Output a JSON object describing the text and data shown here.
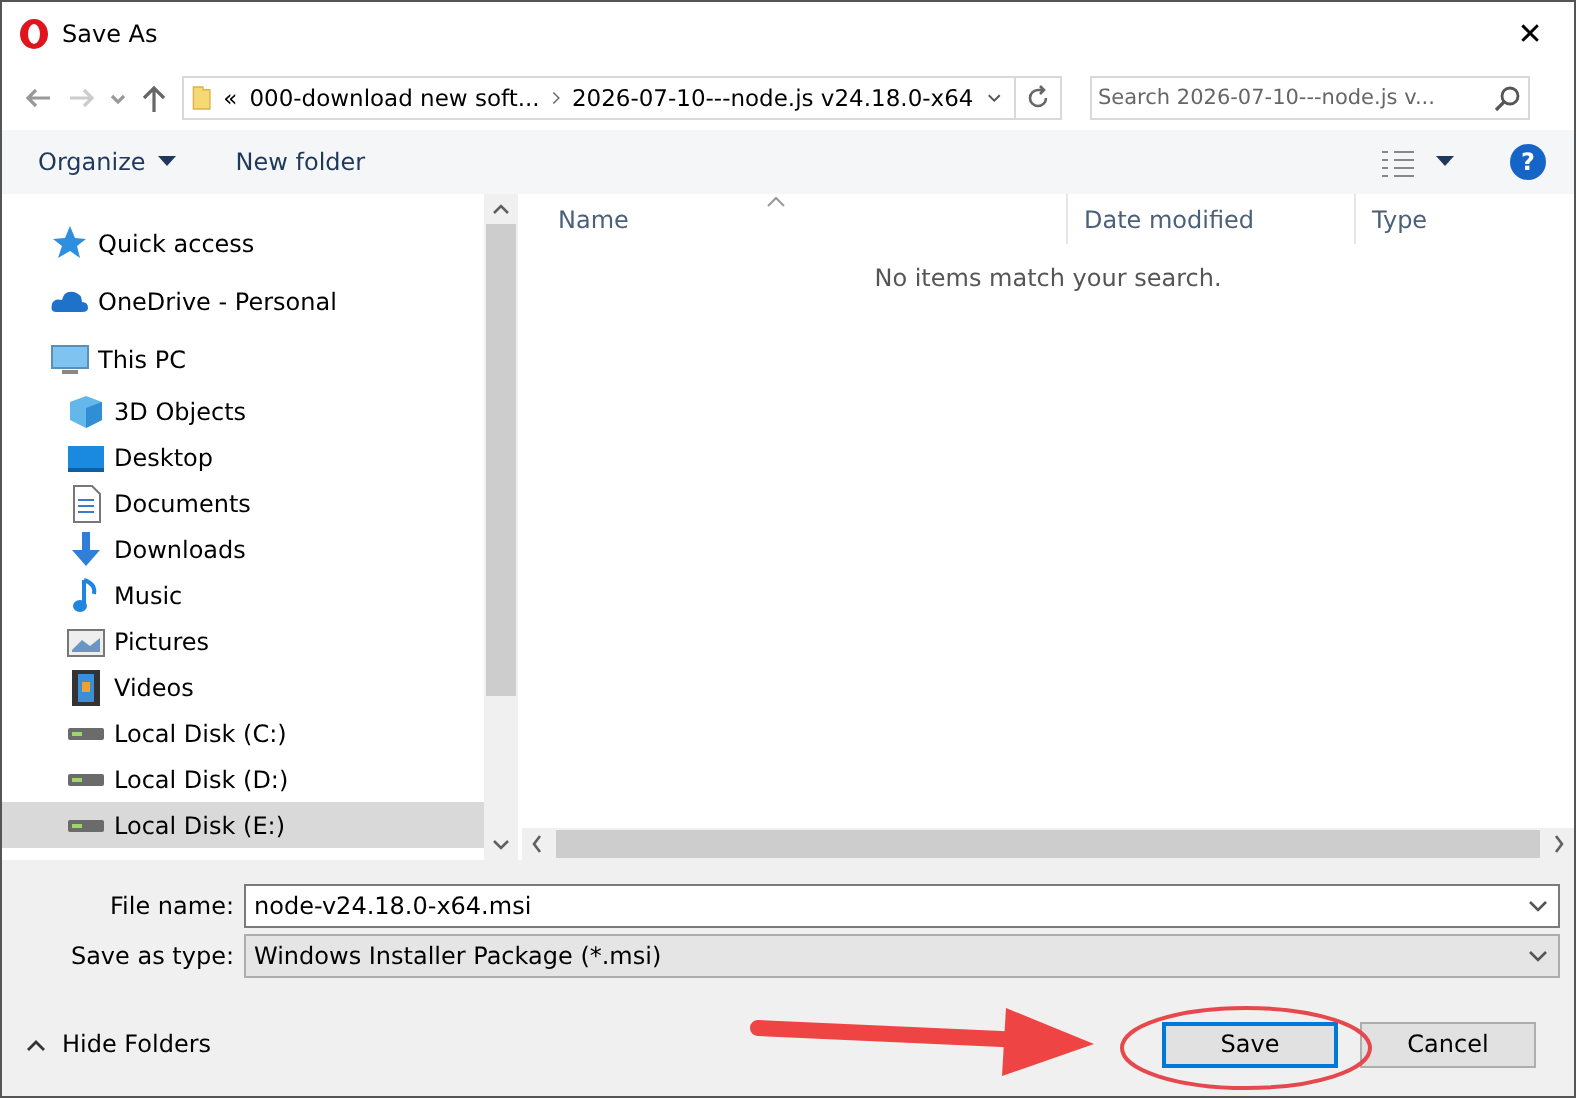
{
  "window": {
    "title": "Save As",
    "close": "✕"
  },
  "address": {
    "overflow": "«",
    "segments": [
      "000-download new soft...",
      "2026-07-10---node.js v24.18.0-x64"
    ]
  },
  "search": {
    "placeholder": "Search 2026-07-10---node.js v..."
  },
  "toolbar": {
    "organize": "Organize",
    "new_folder": "New folder",
    "help": "?"
  },
  "sidebar": {
    "items": [
      {
        "label": "Quick access",
        "kind": "star",
        "selected": false
      },
      {
        "label": "OneDrive - Personal",
        "kind": "cloud",
        "selected": false
      },
      {
        "label": "This PC",
        "kind": "pc",
        "selected": false,
        "children": [
          {
            "label": "3D Objects",
            "kind": "cube",
            "selected": false
          },
          {
            "label": "Desktop",
            "kind": "desktop",
            "selected": false
          },
          {
            "label": "Documents",
            "kind": "doc",
            "selected": false
          },
          {
            "label": "Downloads",
            "kind": "download",
            "selected": false
          },
          {
            "label": "Music",
            "kind": "music",
            "selected": false
          },
          {
            "label": "Pictures",
            "kind": "pictures",
            "selected": false
          },
          {
            "label": "Videos",
            "kind": "video",
            "selected": false
          },
          {
            "label": "Local Disk (C:)",
            "kind": "disk",
            "selected": false
          },
          {
            "label": "Local Disk (D:)",
            "kind": "disk",
            "selected": false
          },
          {
            "label": "Local Disk (E:)",
            "kind": "disk",
            "selected": true
          }
        ]
      }
    ]
  },
  "file_list": {
    "columns": [
      {
        "label": "Name",
        "sorted": true
      },
      {
        "label": "Date modified",
        "sorted": false
      },
      {
        "label": "Type",
        "sorted": false
      }
    ],
    "empty_message": "No items match your search."
  },
  "form": {
    "file_name": {
      "label": "File name:",
      "value": "node-v24.18.0-x64.msi"
    },
    "save_as_type": {
      "label": "Save as type:",
      "value": "Windows Installer Package (*.msi)"
    }
  },
  "hide_folders": "Hide Folders",
  "buttons": [
    {
      "label": "Save",
      "default": true
    },
    {
      "label": "Cancel",
      "default": false
    }
  ]
}
